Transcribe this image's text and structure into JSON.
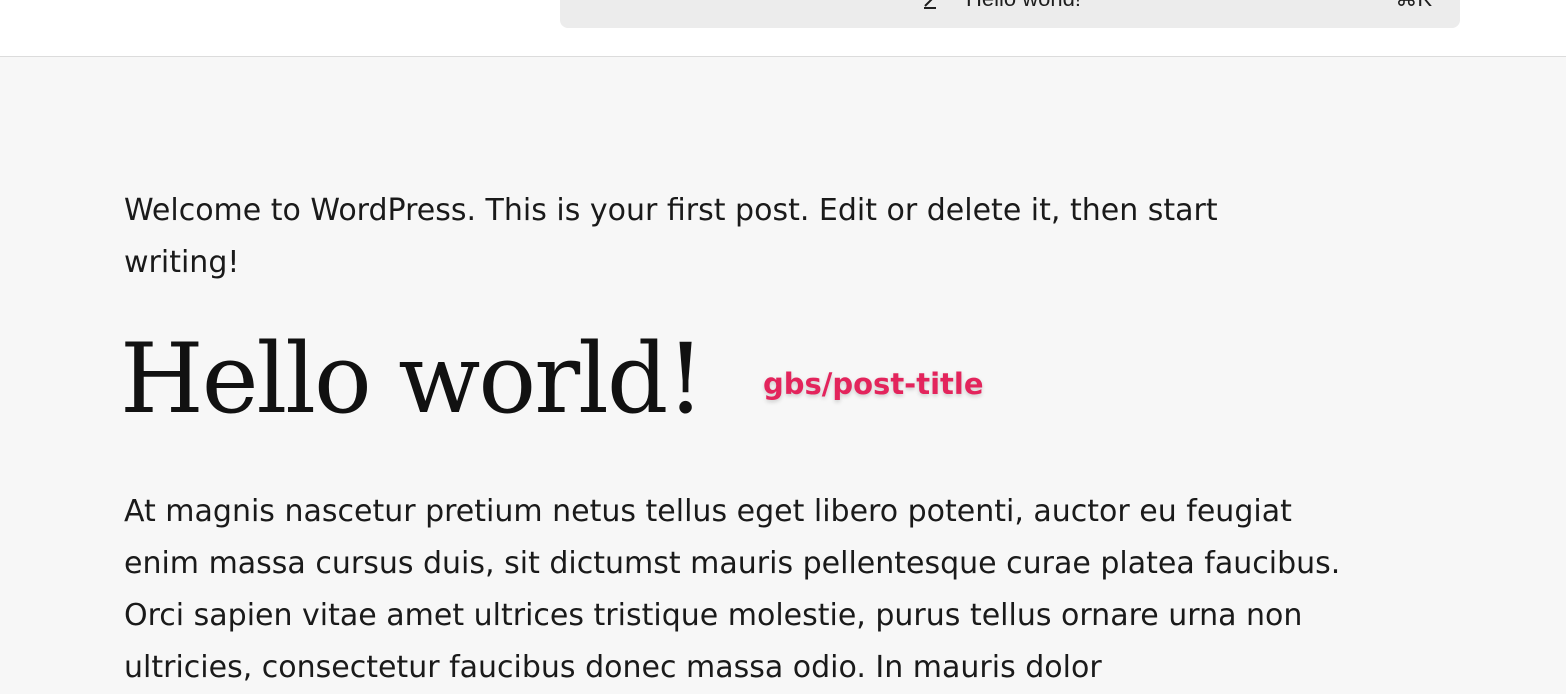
{
  "header": {
    "command_bar": {
      "icon": "document-edit-icon",
      "title": "Hello world!",
      "shortcut": "⌘K"
    }
  },
  "post": {
    "intro": "Welcome to WordPress. This is your first post. Edit or delete it, then start writing!",
    "title": "Hello world!",
    "title_block_label": "gbs/post-title",
    "body": "At magnis nascetur pretium netus tellus eget libero potenti, auctor eu feugiat enim massa cursus duis, sit dictumst mauris pellentesque curae platea faucibus. Orci sapien vitae amet ultrices tristique molestie, purus tellus ornare urna non ultricies, consectetur faucibus donec massa odio. In mauris dolor"
  },
  "colors": {
    "canvas_bg": "#f7f7f7",
    "command_bar_bg": "#ececec",
    "block_label": "#e3245c"
  }
}
